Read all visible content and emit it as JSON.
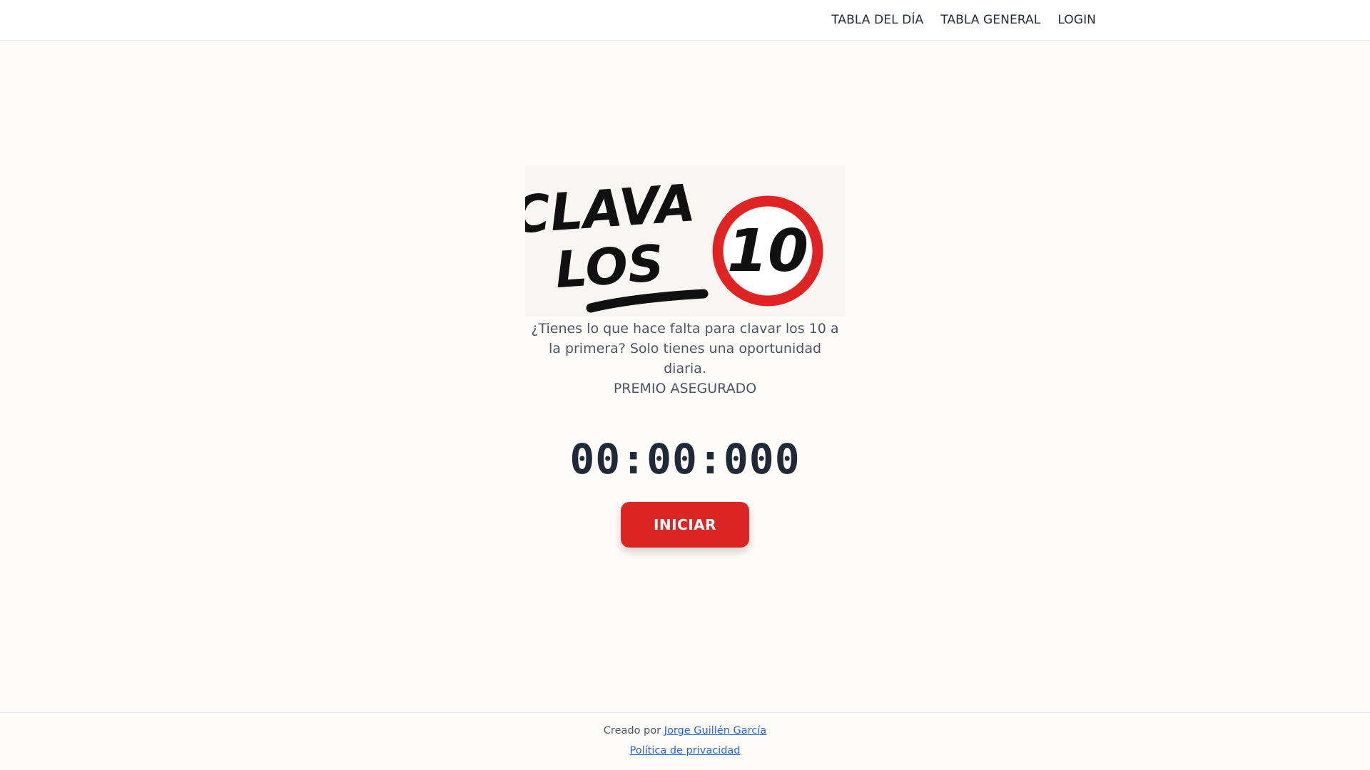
{
  "nav": {
    "items": [
      {
        "label": "TABLA DEL DÍA"
      },
      {
        "label": "TABLA GENERAL"
      },
      {
        "label": "LOGIN"
      }
    ]
  },
  "logo": {
    "text_line1": "CLAVA",
    "text_line2": "LOS",
    "number": "10",
    "accent_color": "#e02424"
  },
  "intro": {
    "tagline": "¿Tienes lo que hace falta para clavar los 10 a la primera? Solo tienes una oportunidad diaria.",
    "prize": "PREMIO ASEGURADO"
  },
  "timer": {
    "display": "00:00:000"
  },
  "actions": {
    "start_label": "INICIAR"
  },
  "footer": {
    "created_by_prefix": "Creado por",
    "author": "Jorge Guillén García",
    "privacy_label": "Política de privacidad"
  },
  "colors": {
    "primary": "#dc2626",
    "background": "#fdfcf8",
    "link": "#2563eb"
  }
}
